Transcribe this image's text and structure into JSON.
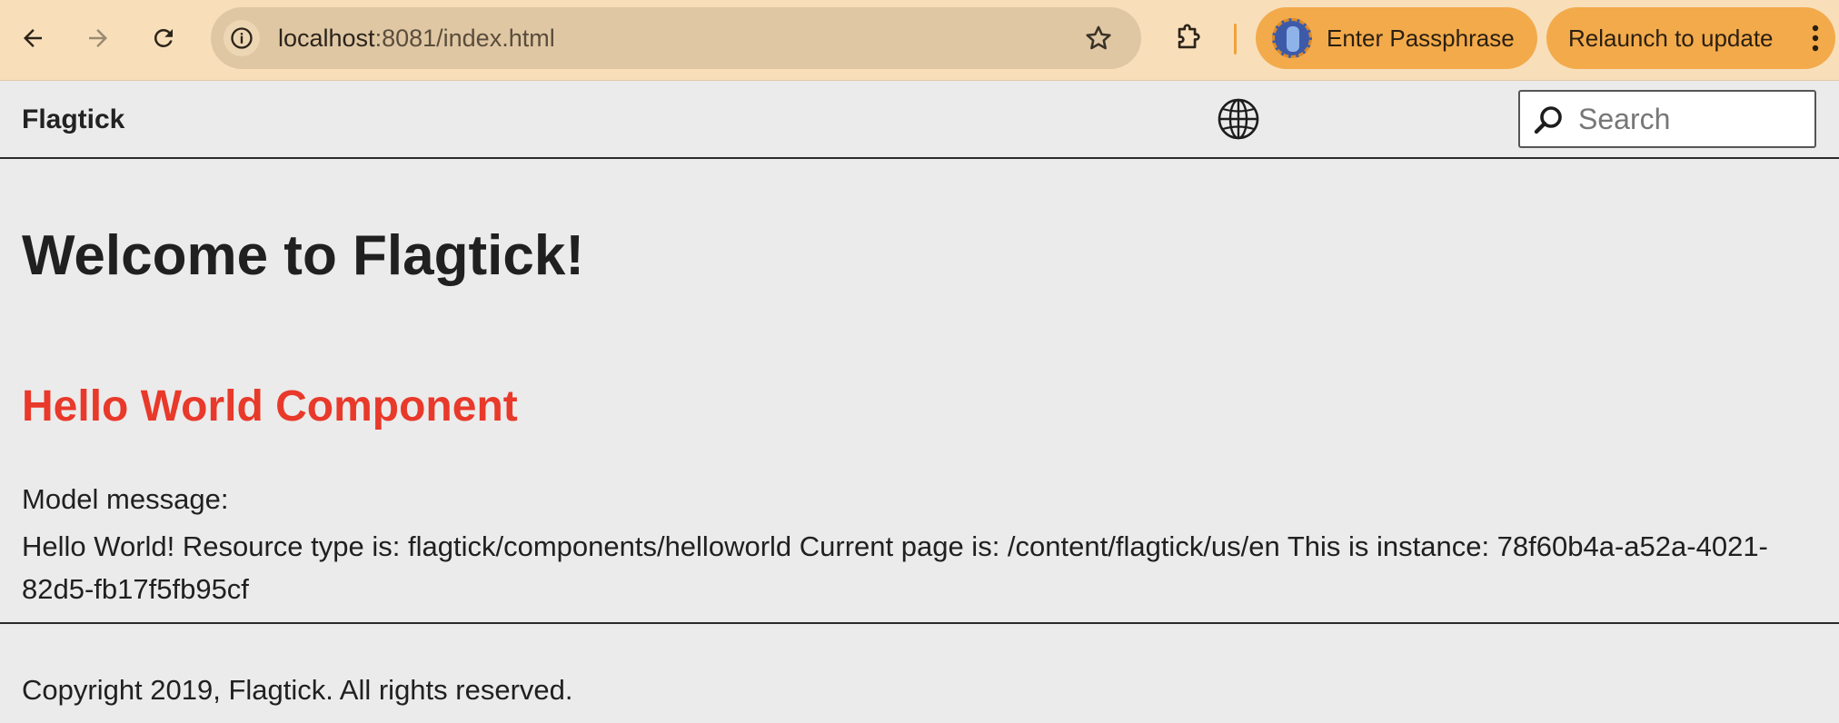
{
  "browser": {
    "url_host": "localhost",
    "url_rest": ":8081/index.html",
    "extensions": {
      "passphrase_label": "Enter Passphrase",
      "update_label": "Relaunch to update"
    }
  },
  "header": {
    "brand": "Flagtick",
    "search": {
      "placeholder": "Search"
    }
  },
  "main": {
    "heading": "Welcome to Flagtick!",
    "component_title": "Hello World Component",
    "model_label": "Model message:",
    "model_message": "Hello World! Resource type is: flagtick/components/helloworld Current page is: /content/flagtick/us/en This is instance: 78f60b4a-a52a-4021-82d5-fb17f5fb95cf"
  },
  "footer": {
    "copyright": "Copyright 2019, Flagtick. All rights reserved."
  },
  "colors": {
    "toolbar": "#f8dfba",
    "omnibox": "#e0c7a4",
    "pill": "#f3aa4b",
    "page_bg": "#ebebeb",
    "component_title": "#e8392a"
  }
}
